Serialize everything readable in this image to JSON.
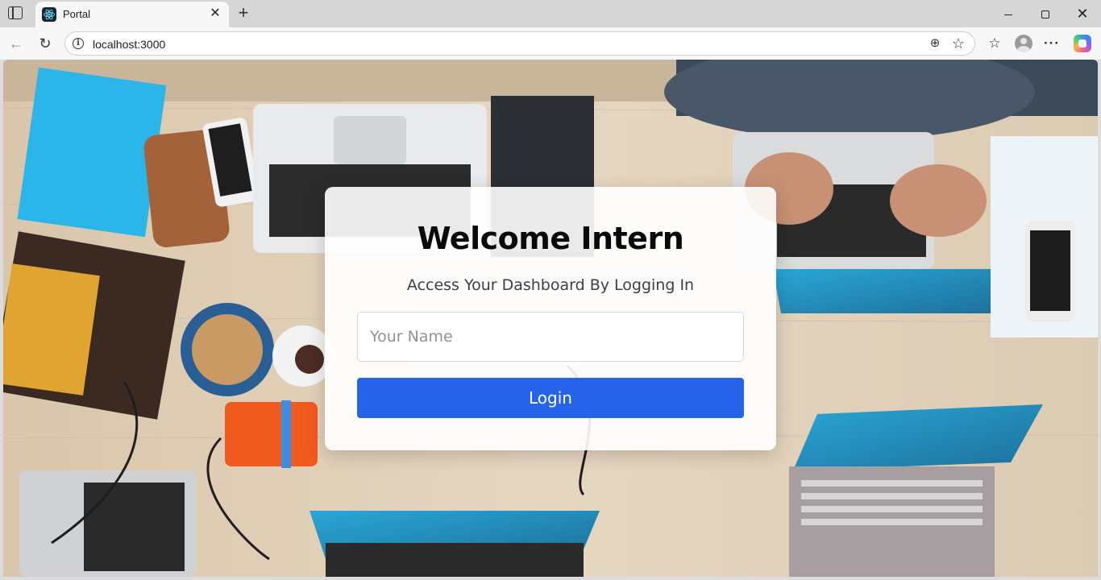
{
  "browser": {
    "tab": {
      "title": "Portal",
      "favicon": "react-icon"
    },
    "address_bar": {
      "url": "localhost:3000"
    }
  },
  "page": {
    "title": "Welcome Intern",
    "subtitle": "Access Your Dashboard By Logging In",
    "name_input": {
      "placeholder": "Your Name",
      "value": ""
    },
    "login_button": "Login",
    "accent_color": "#2563eb"
  }
}
